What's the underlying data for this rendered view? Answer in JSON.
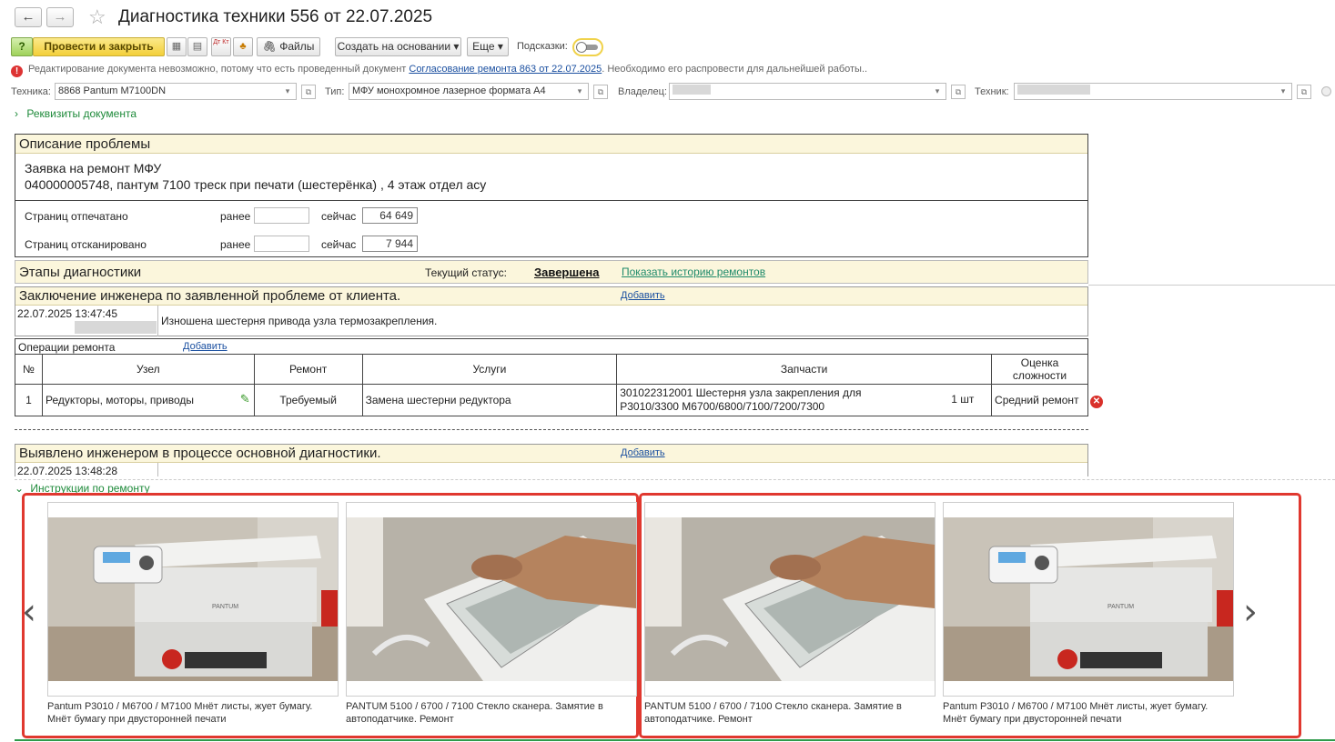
{
  "window": {
    "title": "Диагностика техники 556 от 22.07.2025",
    "back_icon": "←",
    "forward_icon": "→",
    "star_icon": "☆"
  },
  "toolbar": {
    "post_close": "Провести и закрыть",
    "dt_kt": "Дт Кт",
    "files": "Файлы",
    "create_based": "Создать на основании ▾",
    "more": "Еще ▾",
    "hints_label": "Подсказки:"
  },
  "warning": {
    "text_before": "Редактирование документа невозможно, потому что есть проведенный документ",
    "link": "Согласование ремонта 863 от 22.07.2025",
    "text_after": ". Необходимо его распровести для дальнейшей работы.."
  },
  "fields": {
    "technika_label": "Техника:",
    "technika_value": "8868 Pantum M7100DN",
    "type_label": "Тип:",
    "type_value": "МФУ монохромное лазерное формата А4",
    "owner_label": "Владелец:",
    "tech_label": "Техник:"
  },
  "requisites": "Реквизиты документа",
  "problem": {
    "header": "Описание проблемы",
    "line1": "Заявка на ремонт МФУ",
    "line2": "040000005748, пантум 7100 треск при печати (шестерёнка) , 4 этаж отдел асу",
    "printed_label": "Страниц отпечатано",
    "scanned_label": "Страниц отсканировано",
    "before_label": "ранее",
    "now_label": "сейчас",
    "printed_now": "64 649",
    "scanned_now": "7 944"
  },
  "stages": {
    "header": "Этапы диагностики",
    "status_label": "Текущий статус:",
    "status_value": "Завершена",
    "history_link": "Показать историю ремонтов"
  },
  "conclusion": {
    "header": "Заключение инженера по заявленной проблеме от клиента.",
    "add": "Добавить",
    "datetime": "22.07.2025 13:47:45",
    "text": "Изношена шестерня привода узла термозакрепления."
  },
  "operations": {
    "label": "Операции ремонта",
    "add": "Добавить",
    "columns": [
      "№",
      "Узел",
      "Ремонт",
      "Услуги",
      "Запчасти",
      "Оценка сложности"
    ],
    "rows": [
      {
        "num": "1",
        "node": "Редукторы, моторы, приводы",
        "repair": "Требуемый",
        "service": "Замена шестерни редуктора",
        "parts": "301022312001 Шестерня узла закрепления для P3010/3300 M6700/6800/7100/7200/7300",
        "qty": "1 шт",
        "complexity": "Средний ремонт"
      }
    ]
  },
  "detected": {
    "header": "Выявлено инженером в процессе основной диагностики.",
    "add": "Добавить",
    "datetime": "22.07.2025 13:48:28"
  },
  "instructions": {
    "label": "Инструкции по ремонту",
    "captions": [
      "Pantum P3010 / M6700 / M7100 Мнёт листы, жует бумагу. Мнёт бумагу при двусторонней печати",
      "PANTUM 5100 / 6700 / 7100 Стекло сканера. Замятие в автоподатчике. Ремонт",
      "PANTUM 5100 / 6700 / 7100 Стекло сканера. Замятие в автоподатчике. Ремонт",
      "Pantum P3010 / M6700 / M7100 Мнёт листы, жует бумагу. Мнёт бумагу при двусторонней печати"
    ],
    "printer_brand": "PANTUM",
    "prev_icon": "‹",
    "next_icon": "›"
  }
}
